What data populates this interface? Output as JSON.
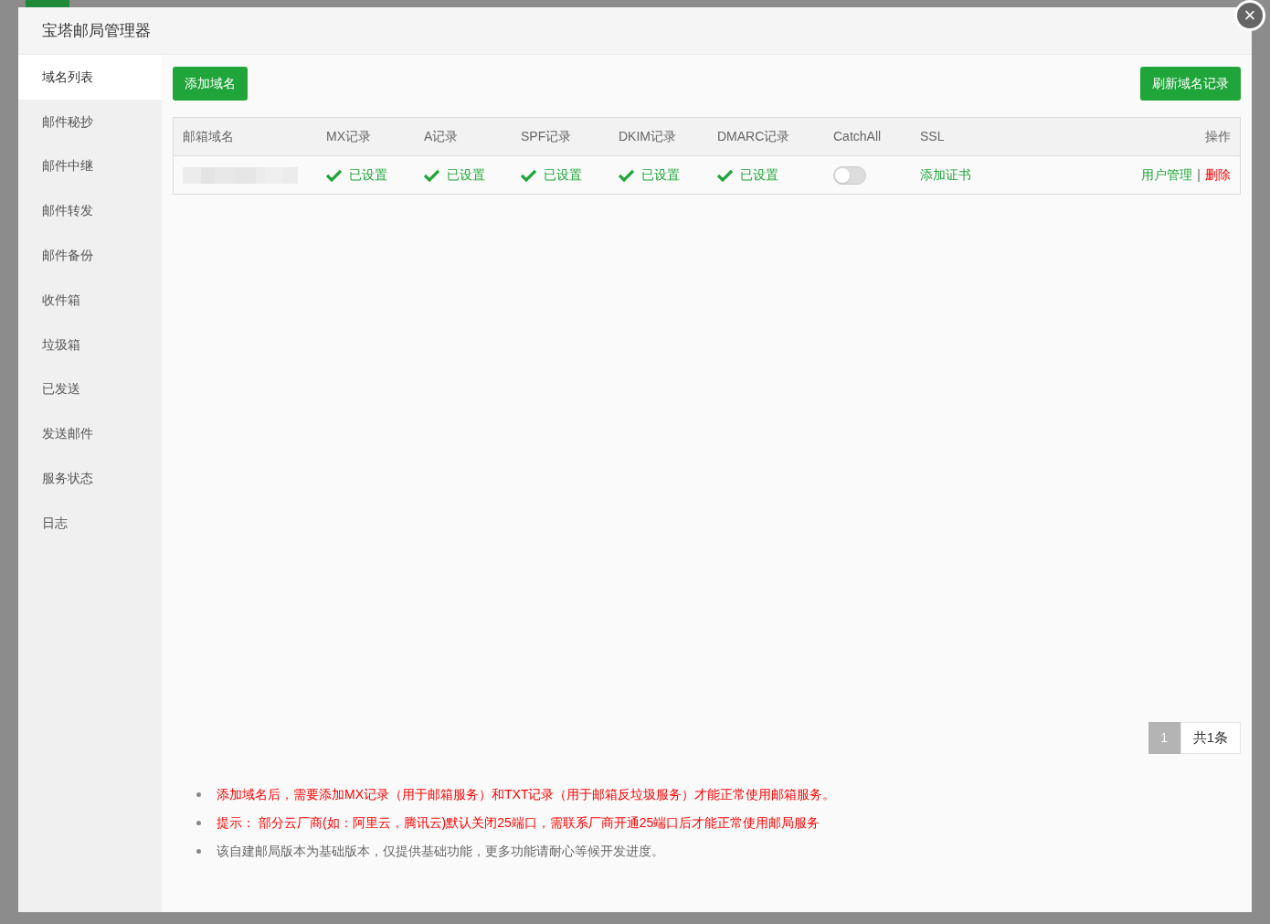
{
  "window": {
    "title": "宝塔邮局管理器",
    "close": "×"
  },
  "sidebar": {
    "items": [
      {
        "label": "域名列表",
        "selected": true
      },
      {
        "label": "邮件秘抄",
        "selected": false
      },
      {
        "label": "邮件中继",
        "selected": false
      },
      {
        "label": "邮件转发",
        "selected": false
      },
      {
        "label": "邮件备份",
        "selected": false
      },
      {
        "label": "收件箱",
        "selected": false
      },
      {
        "label": "垃圾箱",
        "selected": false
      },
      {
        "label": "已发送",
        "selected": false
      },
      {
        "label": "发送邮件",
        "selected": false
      },
      {
        "label": "服务状态",
        "selected": false
      },
      {
        "label": "日志",
        "selected": false
      }
    ]
  },
  "toolbar": {
    "add_button": "添加域名",
    "refresh_button": "刷新域名记录"
  },
  "table": {
    "columns": [
      "邮箱域名",
      "MX记录",
      "A记录",
      "SPF记录",
      "DKIM记录",
      "DMARC记录",
      "CatchAll",
      "SSL",
      "操作"
    ],
    "rows": [
      {
        "domain": {
          "kind": "picture"
        },
        "records": [
          {
            "text": "已设置",
            "ok": true
          },
          {
            "text": "已设置",
            "ok": true
          },
          {
            "text": "已设置",
            "ok": true
          },
          {
            "text": "已设置",
            "ok": true
          },
          {
            "text": "已设置",
            "ok": true
          }
        ],
        "catchall": {
          "on": false
        },
        "ssl": "添加证书",
        "actions": [
          "用户管理",
          "删除"
        ],
        "separator": "|"
      }
    ]
  },
  "pagination": {
    "pages": [
      {
        "label": "1",
        "selected": true
      }
    ],
    "total": "共1条"
  },
  "notes": [
    {
      "text": "添加域名后，需要添加MX记录（用于邮箱服务）和TXT记录（用于邮箱反垃圾服务）才能正常使用邮箱服务。",
      "color": "#ff0000"
    },
    {
      "text": "提示： 部分云厂商(如：阿里云，腾讯云)默认关闭25端口，需联系厂商开通25端口后才能正常使用邮局服务",
      "color": "#ff0000"
    },
    {
      "text": "该自建邮局版本为基础版本，仅提供基础功能，更多功能请耐心等候开发进度。",
      "color": "#666666"
    }
  ]
}
